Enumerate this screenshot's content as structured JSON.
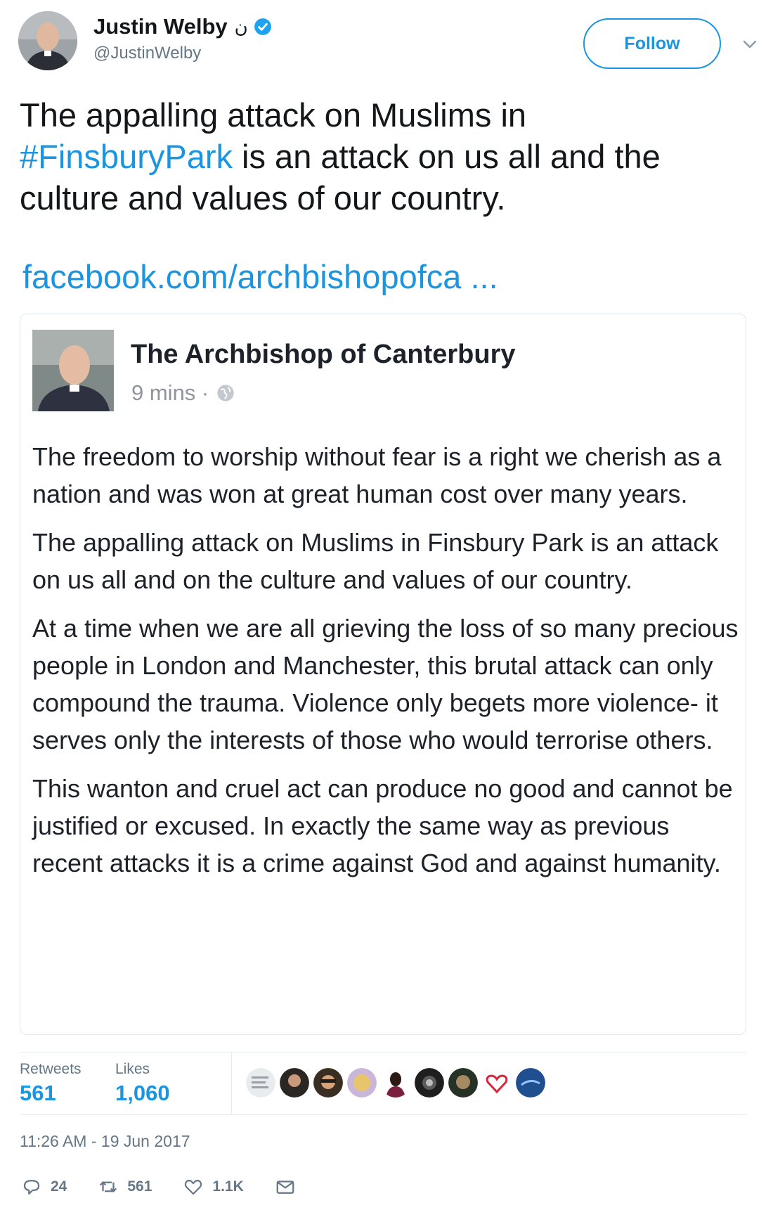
{
  "header": {
    "display_name": "Justin Welby",
    "name_mark": "ن",
    "handle": "@JustinWelby",
    "follow_label": "Follow"
  },
  "tweet": {
    "text_before": "The appalling attack on Muslims in",
    "hashtag": "#FinsburyPark",
    "text_after": " is an attack on us all and the culture and values of our country.",
    "link": "facebook.com/archbishopofca ..."
  },
  "card": {
    "name": "The Archbishop of Canterbury",
    "time": "9 mins ·",
    "paragraphs": [
      "The freedom to worship without fear is a right we cherish as a nation and was won at great human cost over many years.",
      "The appalling attack on Muslims in Finsbury Park is an attack on us all and on the culture and values of our country.",
      "At a time when we are all grieving the loss of so many precious people in London and Manchester, this brutal attack can only compound the trauma. Violence only begets more violence- it serves only the interests of those who would terrorise others.",
      "This wanton and cruel act can produce no good and cannot be justified or excused. In exactly the same way as previous recent attacks it is a crime against God and against humanity."
    ]
  },
  "stats": {
    "retweets_label": "Retweets",
    "retweets_value": "561",
    "likes_label": "Likes",
    "likes_value": "1,060"
  },
  "timestamp": "11:26 AM - 19 Jun 2017",
  "actions": {
    "reply_count": "24",
    "retweet_count": "561",
    "like_count": "1.1K"
  },
  "colors": {
    "accent": "#1b95e0",
    "muted": "#657786"
  }
}
